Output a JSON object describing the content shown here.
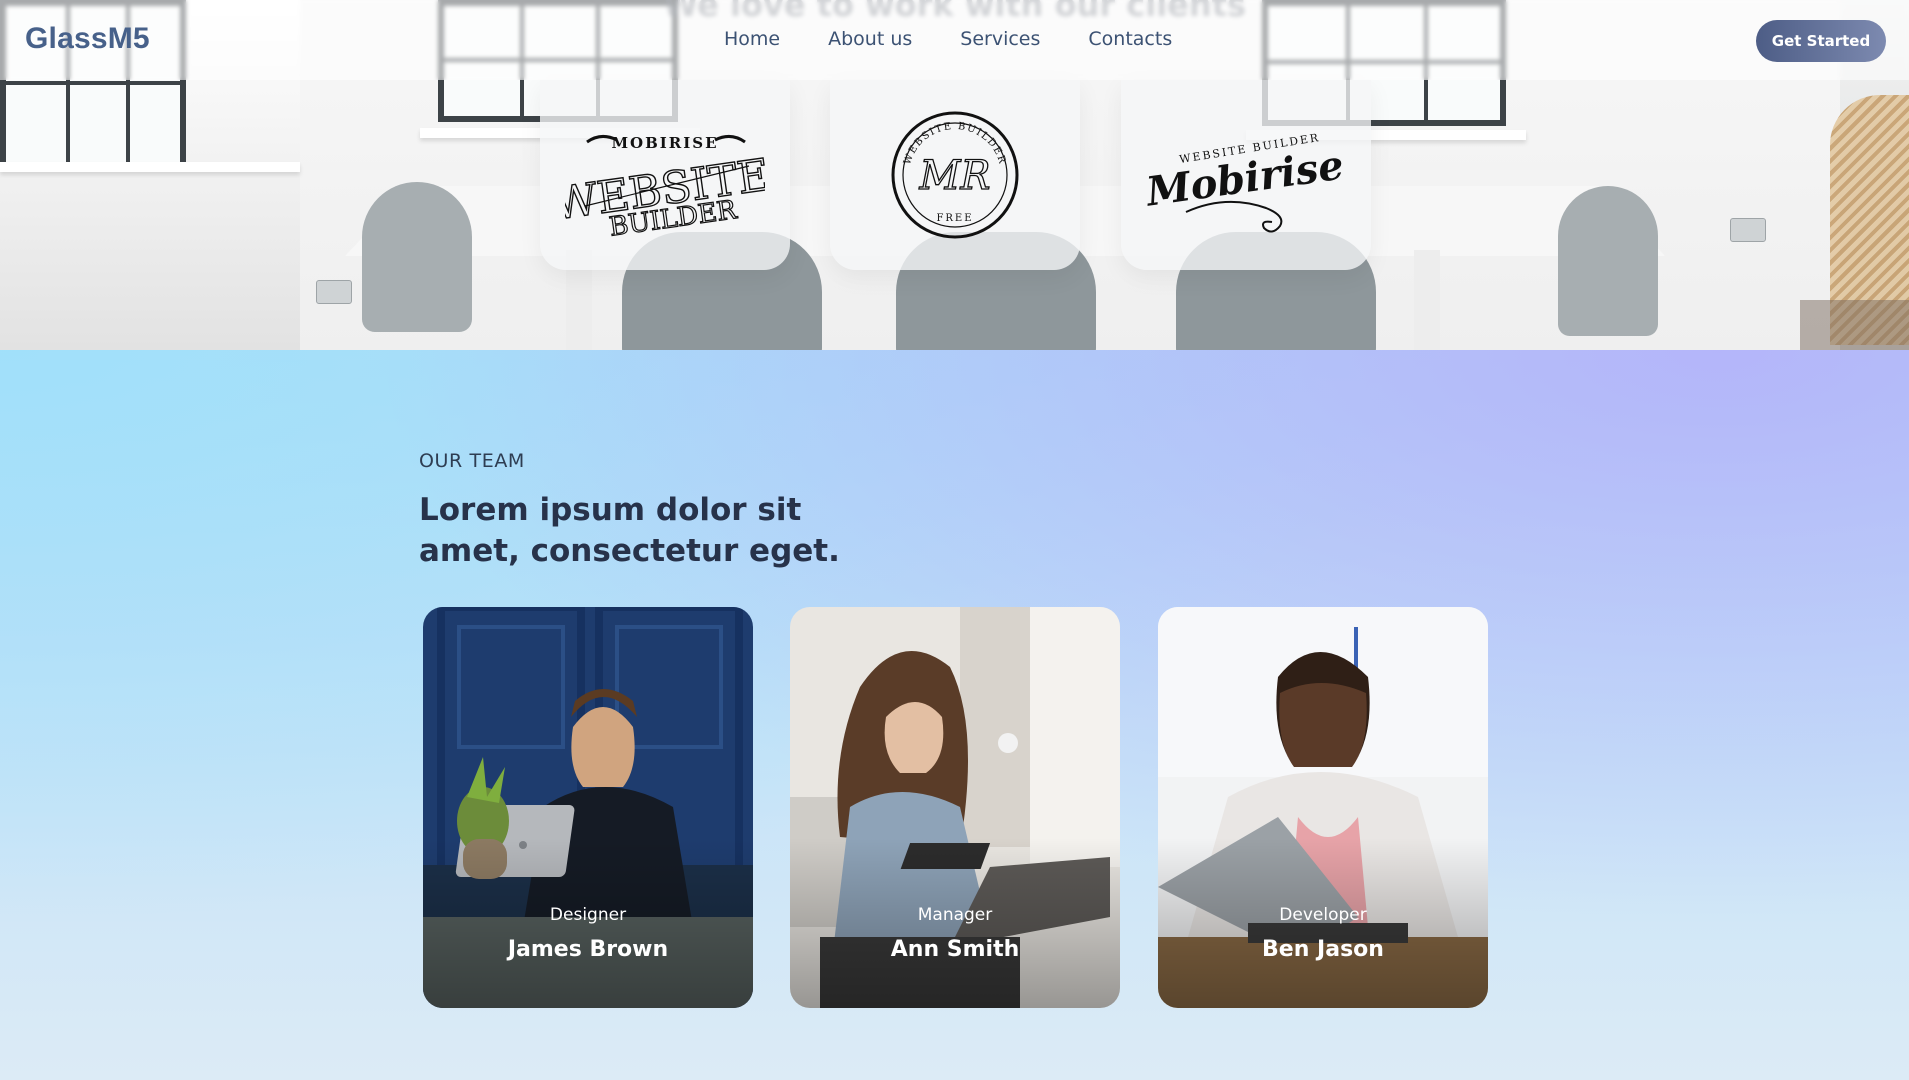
{
  "nav": {
    "brand": "GlassM5",
    "links": [
      {
        "label": "Home"
      },
      {
        "label": "About us"
      },
      {
        "label": "Services"
      },
      {
        "label": "Contacts"
      }
    ],
    "cta_label": "Get Started"
  },
  "clients": {
    "heading": "We love to work with our clients",
    "logos": [
      {
        "icon": "mobirise-website-builder-logo",
        "top_text": "MOBIRISE",
        "main_text": "WEBSITE",
        "bottom_text": "BUILDER"
      },
      {
        "icon": "mr-seal-logo",
        "ring_top": "WEBSITE BUILDER",
        "monogram": "MR",
        "ring_bottom": "FREE"
      },
      {
        "icon": "mobirise-script-logo",
        "top_text": "WEBSITE BUILDER",
        "main_text": "Mobirise"
      }
    ]
  },
  "team": {
    "eyebrow": "OUR TEAM",
    "headline": "Lorem ipsum dolor sit amet, consectetur eget.",
    "members": [
      {
        "role": "Designer",
        "name": "James Brown"
      },
      {
        "role": "Manager",
        "name": "Ann Smith"
      },
      {
        "role": "Developer",
        "name": "Ben Jason"
      }
    ]
  },
  "colors": {
    "brand": "#47618a",
    "nav_text": "#3c5273",
    "cta_start": "#4d5d86",
    "cta_end": "#7d8ab0",
    "heading": "#27324a"
  }
}
